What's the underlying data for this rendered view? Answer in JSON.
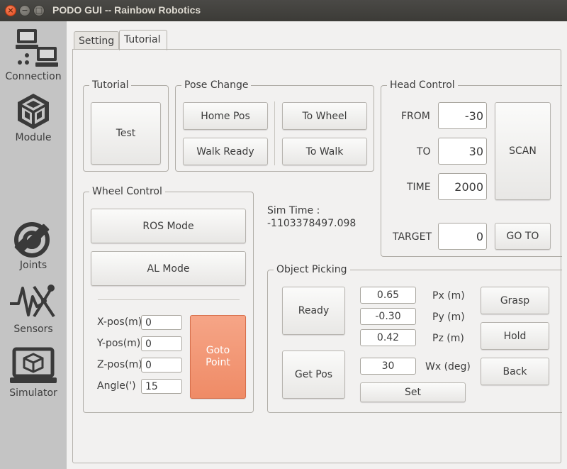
{
  "window": {
    "title": "PODO GUI -- Rainbow Robotics",
    "close_glyph": "×",
    "minimize_glyph": "−",
    "maximize_glyph": "□"
  },
  "sidebar": {
    "items": [
      {
        "label": "Connection",
        "icon": "connection-icon"
      },
      {
        "label": "Module",
        "icon": "module-icon"
      },
      {
        "label": "Joints",
        "icon": "joints-icon"
      },
      {
        "label": "Sensors",
        "icon": "sensors-icon"
      },
      {
        "label": "Simulator",
        "icon": "simulator-icon"
      }
    ]
  },
  "tabs": {
    "setting": "Setting",
    "tutorial": "Tutorial",
    "active": "Tutorial"
  },
  "tutorial_group": {
    "title": "Tutorial",
    "test_label": "Test"
  },
  "pose_change": {
    "title": "Pose Change",
    "home_pos": "Home Pos",
    "walk_ready": "Walk Ready",
    "to_wheel": "To Wheel",
    "to_walk": "To Walk"
  },
  "head_control": {
    "title": "Head Control",
    "from_label": "FROM",
    "from_value": "-30",
    "to_label": "TO",
    "to_value": "30",
    "time_label": "TIME",
    "time_value": "2000",
    "scan_label": "SCAN",
    "target_label": "TARGET",
    "target_value": "0",
    "goto_label": "GO TO"
  },
  "wheel_control": {
    "title": "Wheel Control",
    "ros_mode": "ROS Mode",
    "al_mode": "AL Mode",
    "xpos_label": "X-pos(m)",
    "xpos_value": "0",
    "ypos_label": "Y-pos(m)",
    "ypos_value": "0",
    "zpos_label": "Z-pos(m)",
    "zpos_value": "0",
    "angle_label": "Angle(')",
    "angle_value": "15",
    "goto_point_line1": "Goto",
    "goto_point_line2": "Point"
  },
  "sim_time": {
    "label": "Sim Time :",
    "value": "-1103378497.098"
  },
  "object_picking": {
    "title": "Object Picking",
    "ready": "Ready",
    "get_pos": "Get Pos",
    "px_value": "0.65",
    "px_label": "Px (m)",
    "py_value": "-0.30",
    "py_label": "Py (m)",
    "pz_value": "0.42",
    "pz_label": "Pz (m)",
    "wx_value": "30",
    "wx_label": "Wx (deg)",
    "set": "Set",
    "grasp": "Grasp",
    "hold": "Hold",
    "back": "Back"
  },
  "colors": {
    "titlebar": "#3c3b37",
    "sidebar": "#c4c4c4",
    "window_bg": "#f2f1f0",
    "accent_orange": "#ef8b66",
    "close_button": "#e2461c"
  }
}
